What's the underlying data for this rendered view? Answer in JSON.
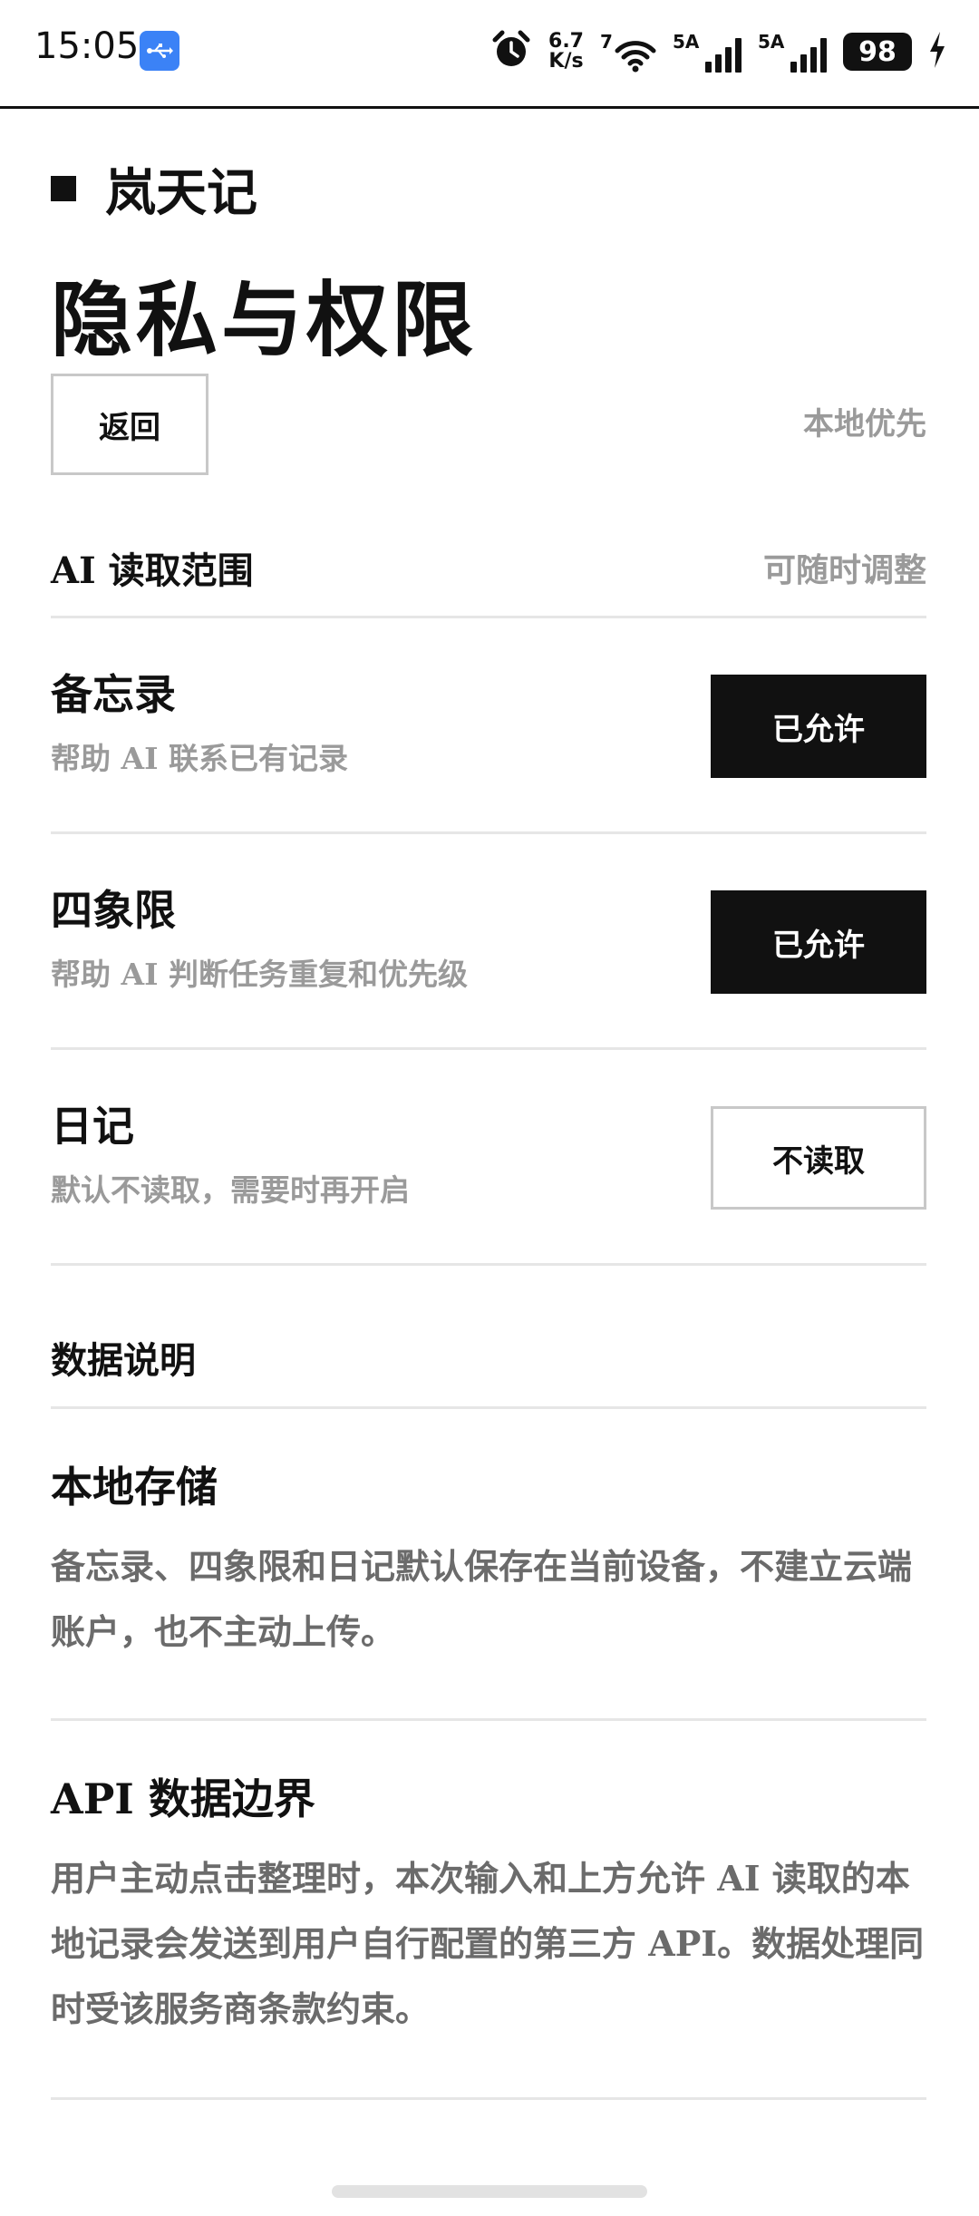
{
  "status_bar": {
    "time": "15:05",
    "net_speed_value": "6.7",
    "net_speed_unit": "K/s",
    "wifi_label": "7",
    "sim1_label": "5A",
    "sim2_label": "5A",
    "battery": "98",
    "icons": [
      "usb-icon",
      "alarm-icon",
      "wifi-icon",
      "signal-icon",
      "battery-icon",
      "charging-icon"
    ]
  },
  "header": {
    "brand": "岚天记",
    "title": "隐私与权限",
    "back_label": "返回",
    "local_first": "本地优先"
  },
  "ai_scope": {
    "title": "AI 读取范围",
    "hint": "可随时调整",
    "items": [
      {
        "name": "备忘录",
        "desc": "帮助 AI 联系已有记录",
        "status": "已允许",
        "allowed": true
      },
      {
        "name": "四象限",
        "desc": "帮助 AI 判断任务重复和优先级",
        "status": "已允许",
        "allowed": true
      },
      {
        "name": "日记",
        "desc": "默认不读取，需要时再开启",
        "status": "不读取",
        "allowed": false
      }
    ]
  },
  "data_notes": {
    "title": "数据说明",
    "local_storage": {
      "title": "本地存储",
      "body": "备忘录、四象限和日记默认保存在当前设备，不建立云端账户，也不主动上传。"
    },
    "api_boundary": {
      "title": "API 数据边界",
      "body": "用户主动点击整理时，本次输入和上方允许 AI 读取的本地记录会发送到用户自行配置的第三方 API。数据处理同时受该服务商条款约束。"
    }
  },
  "colors": {
    "accent": "#111111",
    "muted_text": "#9a9a9a",
    "divider": "#e6e6e6",
    "usb_badge": "#3b82f6"
  }
}
